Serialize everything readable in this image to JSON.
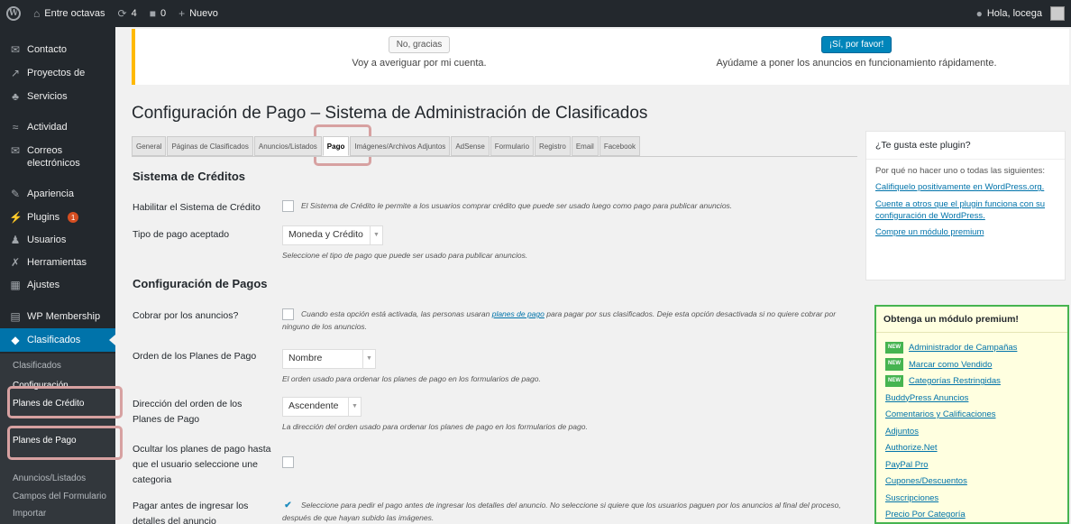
{
  "adminbar": {
    "site_name": "Entre octavas",
    "updates_count": "4",
    "comments_count": "0",
    "new_label": "Nuevo",
    "greeting": "Hola, locega"
  },
  "sidebar": {
    "items": [
      {
        "label": "Contacto",
        "icon": "envelope-icon"
      },
      {
        "label": "Proyectos de",
        "icon": "pin-icon"
      },
      {
        "label": "Servicios",
        "icon": "people-icon"
      },
      {
        "label": "Actividad",
        "icon": "activity-icon"
      },
      {
        "label": "Correos electrónicos",
        "icon": "envelope-icon"
      },
      {
        "label": "Apariencia",
        "icon": "brush-icon"
      },
      {
        "label": "Plugins",
        "icon": "plug-icon",
        "badge": "1"
      },
      {
        "label": "Usuarios",
        "icon": "user-icon"
      },
      {
        "label": "Herramientas",
        "icon": "wrench-icon"
      },
      {
        "label": "Ajustes",
        "icon": "settings-icon"
      },
      {
        "label": "WP Membership",
        "icon": "membership-icon"
      },
      {
        "label": "Clasificados",
        "icon": "pin-icon"
      }
    ],
    "submenu": [
      "Clasificados",
      "Configuración",
      "Planes de Crédito",
      "Planes de Pago",
      "Anuncios/Listados",
      "Campos del Formulario",
      "Importar"
    ]
  },
  "notice": {
    "left_button": "No, gracias",
    "left_text": "Voy a averiguar por mi cuenta.",
    "right_button": "¡Sí, por favor!",
    "right_text": "Ayúdame a poner los anuncios en funcionamiento rápidamente."
  },
  "page_title": "Configuración de Pago – Sistema de Administración de Clasificados",
  "tabs": [
    "General",
    "Páginas de Clasificados",
    "Anuncios/Listados",
    "Pago",
    "Imágenes/Archivos Adjuntos",
    "AdSense",
    "Formulario",
    "Registro",
    "Email",
    "Facebook"
  ],
  "credits_section": {
    "title": "Sistema de Créditos",
    "enable_label": "Habilitar el Sistema de Crédito",
    "enable_desc": "El Sistema de Crédito le permite a los usuarios comprar crédito que puede ser usado luego como pago para publicar anuncios.",
    "payment_type_label": "Tipo de pago aceptado",
    "payment_type_value": "Moneda y Crédito",
    "payment_type_desc": "Seleccione el tipo de pago que puede ser usado para publicar anuncios."
  },
  "payments_section": {
    "title": "Configuración de Pagos",
    "charge_label": "Cobrar por los anuncios?",
    "charge_desc_before": "Cuando esta opción está activada, las personas usaran",
    "charge_desc_link": "planes de pago",
    "charge_desc_after": "para pagar por sus clasificados. Deje esta opción desactivada si no quiere cobrar por ninguno de los anuncios.",
    "order_label": "Orden de los Planes de Pago",
    "order_value": "Nombre",
    "order_desc": "El orden usado para ordenar los planes de pago en los formularios de pago.",
    "direction_label": "Dirección del orden de los Planes de Pago",
    "direction_value": "Ascendente",
    "direction_desc": "La dirección del orden usado para ordenar los planes de pago en los formularios de pago.",
    "hide_label": "Ocultar los planes de pago hasta que el usuario seleccione une categoria",
    "pay_before_label": "Pagar antes de ingresar los detalles del anuncio",
    "pay_before_desc": "Seleccione para pedir el pago antes de ingresar los detalles del anuncio. No seleccione si quiere que los usuarios paguen por los anuncios al final del proceso, después de que hayan subido las imágenes."
  },
  "plugin_box": {
    "title": "¿Te gusta este plugin?",
    "text": "Por qué no hacer uno o todas las siguientes:",
    "links": [
      "Califiquelo positivamente en WordPress.org.",
      "Cuente a otros que el plugin funciona con su configuración de WordPress.",
      "Compre un módulo premium"
    ]
  },
  "premium_box": {
    "title": "Obtenga un módulo premium!",
    "new_tag": "NEW",
    "items": [
      {
        "label": "Administrador de Campañas",
        "new": true
      },
      {
        "label": "Marcar como Vendido",
        "new": true
      },
      {
        "label": "Categorías Restringidas",
        "new": true
      },
      {
        "label": "BuddyPress Anuncios",
        "new": false
      },
      {
        "label": "Comentarios y Calificaciones",
        "new": false
      },
      {
        "label": "Adjuntos",
        "new": false
      },
      {
        "label": "Authorize.Net",
        "new": false
      },
      {
        "label": "PayPal Pro",
        "new": false
      },
      {
        "label": "Cupones/Descuentos",
        "new": false
      },
      {
        "label": "Suscripciones",
        "new": false
      },
      {
        "label": "Precio Por Categoría",
        "new": false
      }
    ]
  },
  "colors": {
    "accent": "#0073aa",
    "highlight": "#d7a1a1",
    "premium_border": "#46b450",
    "notice_border": "#ffb900"
  }
}
